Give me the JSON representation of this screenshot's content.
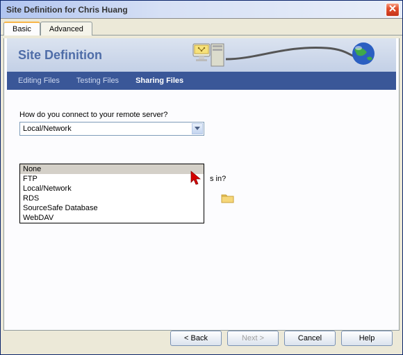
{
  "window": {
    "title": "Site Definition for Chris Huang"
  },
  "tabs": {
    "basic": "Basic",
    "advanced": "Advanced"
  },
  "banner": {
    "title": "Site Definition"
  },
  "steps": {
    "editing": "Editing Files",
    "testing": "Testing Files",
    "sharing": "Sharing Files"
  },
  "body": {
    "question": "How do you connect to your remote server?",
    "selected": "Local/Network",
    "options": [
      "None",
      "FTP",
      "Local/Network",
      "RDS",
      "SourceSafe Database",
      "WebDAV"
    ],
    "partial_right_text": "s in?"
  },
  "buttons": {
    "back": "< Back",
    "next": "Next >",
    "cancel": "Cancel",
    "help": "Help"
  }
}
